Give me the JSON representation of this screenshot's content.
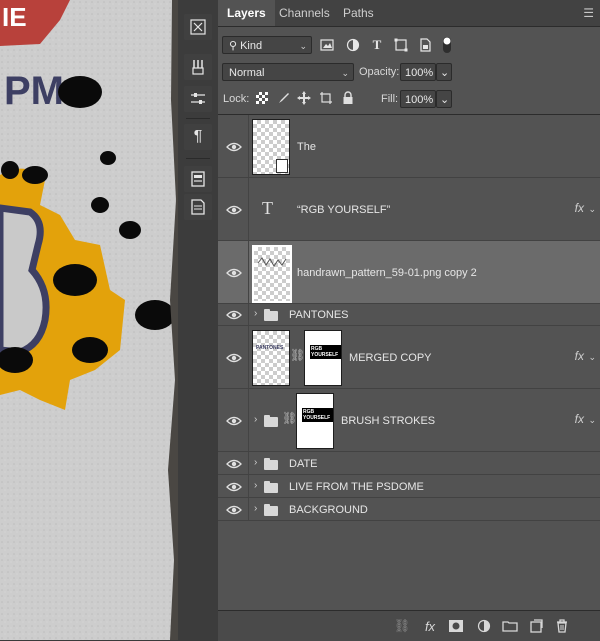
{
  "canvas": {
    "headline_fragment": "PM",
    "top_fragment": "IE"
  },
  "toolstrip": {
    "buttons": [
      "character-icon",
      "brush-presets-icon",
      "adjust-icon",
      "paragraph-icon",
      "properties-icon",
      "notes-icon"
    ]
  },
  "panel": {
    "tabs": [
      {
        "label": "Layers",
        "active": true
      },
      {
        "label": "Channels",
        "active": false
      },
      {
        "label": "Paths",
        "active": false
      }
    ],
    "filter": {
      "kind_label": "Kind"
    },
    "blend_mode": "Normal",
    "opacity_label": "Opacity:",
    "opacity_value": "100%",
    "lock_label": "Lock:",
    "fill_label": "Fill:",
    "fill_value": "100%",
    "layers": [
      {
        "name": "The",
        "type": "smart",
        "selected": false,
        "fx": false
      },
      {
        "name": "“RGB YOURSELF”",
        "type": "text",
        "selected": false,
        "fx": true
      },
      {
        "name": "handrawn_pattern_59-01.png copy 2",
        "type": "pixel",
        "selected": true,
        "fx": false
      },
      {
        "name": "PANTONES",
        "type": "group",
        "selected": false,
        "fx": false
      },
      {
        "name": "MERGED COPY",
        "type": "masked",
        "selected": false,
        "fx": true
      },
      {
        "name": "BRUSH STROKES",
        "type": "group-masked",
        "selected": false,
        "fx": true
      },
      {
        "name": "DATE",
        "type": "group",
        "selected": false,
        "fx": false
      },
      {
        "name": "LIVE FROM THE PSDOME",
        "type": "group",
        "selected": false,
        "fx": false
      },
      {
        "name": "BACKGROUND",
        "type": "group",
        "selected": false,
        "fx": false
      }
    ],
    "thumb_texts": {
      "merged_mask": "RGB YOURSELF",
      "brush_mask": "RGB YOURSELF",
      "merged_thumb": "PANTONES"
    },
    "bottom_icons": [
      "link-layers-icon",
      "fx-icon",
      "add-mask-icon",
      "adjustment-layer-icon",
      "new-group-icon",
      "new-layer-icon",
      "delete-layer-icon"
    ]
  },
  "colors": {
    "panel_bg": "#535353",
    "selected_row": "#6b6b6b",
    "accent_yellow": "#e3a20b",
    "poster_red": "#b8413b",
    "poster_navy": "#3d3f63"
  }
}
